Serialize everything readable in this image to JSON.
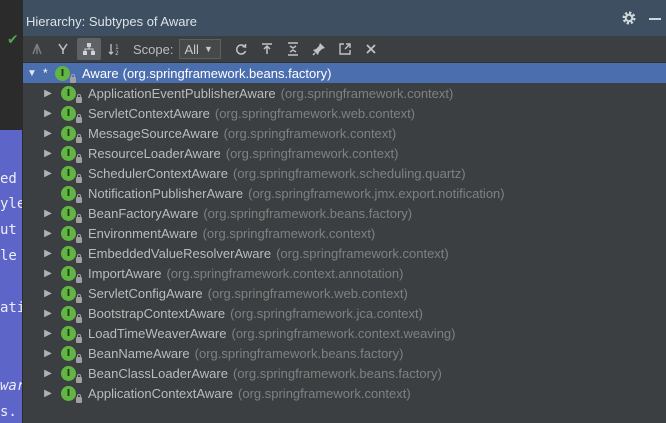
{
  "window": {
    "title": "Hierarchy:",
    "subtitle": "Subtypes of Aware"
  },
  "toolbar": {
    "scope_label": "Scope:",
    "scope_value": "All"
  },
  "icons": {
    "supertypes": "supertypes-icon",
    "subtypes": "subtypes-icon",
    "class-hierarchy": "class-hierarchy-icon",
    "sort": "sort-alpha-icon",
    "refresh": "refresh-icon",
    "export": "export-icon",
    "expand-all": "expand-all-icon",
    "pin": "pin-icon",
    "open-in-editor": "open-in-editor-icon",
    "close": "close-icon",
    "settings": "gear-icon",
    "minimize": "minimize-icon"
  },
  "colors": {
    "selected_row": "#4b6eaf",
    "interface_icon": "#62b543",
    "title_bar": "#3d4f60",
    "panel_bg": "#3c3f41"
  },
  "editor_fragments": [
    "ed",
    "yle",
    "ut",
    "le",
    "atic",
    "war",
    "s."
  ],
  "tree": {
    "root": {
      "marker": "*",
      "name": "Aware",
      "package": "(org.springframework.beans.factory)"
    },
    "children": [
      {
        "name": "ApplicationEventPublisherAware",
        "package": "(org.springframework.context)",
        "expandable": true
      },
      {
        "name": "ServletContextAware",
        "package": "(org.springframework.web.context)",
        "expandable": true
      },
      {
        "name": "MessageSourceAware",
        "package": "(org.springframework.context)",
        "expandable": true
      },
      {
        "name": "ResourceLoaderAware",
        "package": "(org.springframework.context)",
        "expandable": true
      },
      {
        "name": "SchedulerContextAware",
        "package": "(org.springframework.scheduling.quartz)",
        "expandable": true
      },
      {
        "name": "NotificationPublisherAware",
        "package": "(org.springframework.jmx.export.notification)",
        "expandable": false
      },
      {
        "name": "BeanFactoryAware",
        "package": "(org.springframework.beans.factory)",
        "expandable": true
      },
      {
        "name": "EnvironmentAware",
        "package": "(org.springframework.context)",
        "expandable": true
      },
      {
        "name": "EmbeddedValueResolverAware",
        "package": "(org.springframework.context)",
        "expandable": true
      },
      {
        "name": "ImportAware",
        "package": "(org.springframework.context.annotation)",
        "expandable": true
      },
      {
        "name": "ServletConfigAware",
        "package": "(org.springframework.web.context)",
        "expandable": true
      },
      {
        "name": "BootstrapContextAware",
        "package": "(org.springframework.jca.context)",
        "expandable": true
      },
      {
        "name": "LoadTimeWeaverAware",
        "package": "(org.springframework.context.weaving)",
        "expandable": true
      },
      {
        "name": "BeanNameAware",
        "package": "(org.springframework.beans.factory)",
        "expandable": true
      },
      {
        "name": "BeanClassLoaderAware",
        "package": "(org.springframework.beans.factory)",
        "expandable": true
      },
      {
        "name": "ApplicationContextAware",
        "package": "(org.springframework.context)",
        "expandable": true
      }
    ]
  }
}
